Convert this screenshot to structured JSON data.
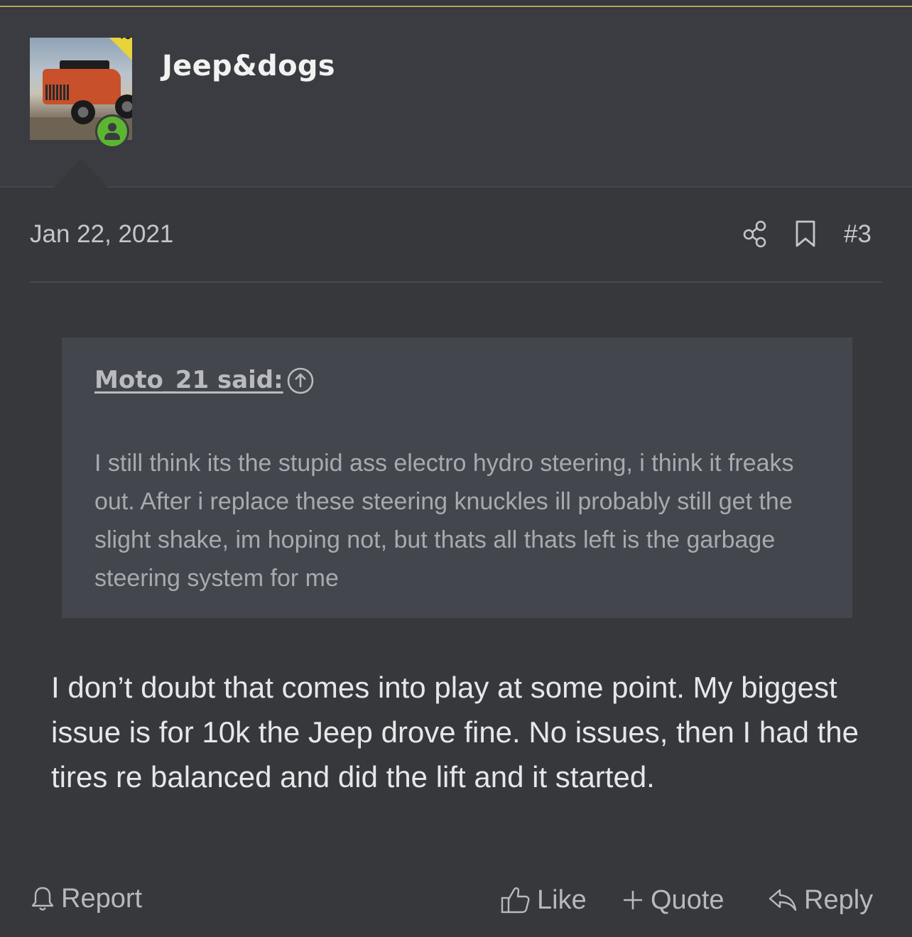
{
  "author": {
    "username": "Jeep&dogs",
    "op_badge": "OP",
    "avatar_icon": "jeep-avatar-photo",
    "online_icon": "user-online-icon"
  },
  "post": {
    "date": "Jan 22, 2021",
    "number": "#3",
    "quote": {
      "author_label": "Moto_21 said:",
      "text": "I still think its the stupid ass electro hydro steering, i think it freaks out. After i replace these steering knuckles ill probably still get the slight shake, im hoping not, but thats all thats left is the garbage steering system for me"
    },
    "body": "I don’t doubt that comes into play at some point. My biggest issue is for 10k the Jeep drove fine. No issues, then I had the tires re balanced and did the lift and it started."
  },
  "actions": {
    "report": "Report",
    "like": "Like",
    "quote": "Quote",
    "reply": "Reply"
  },
  "colors": {
    "background": "#36383c",
    "header": "#3a3c41",
    "accent_rule": "#b8a25a",
    "op_ribbon": "#e7d43a",
    "online": "#5cb531",
    "quote_bg": "#43464d"
  }
}
